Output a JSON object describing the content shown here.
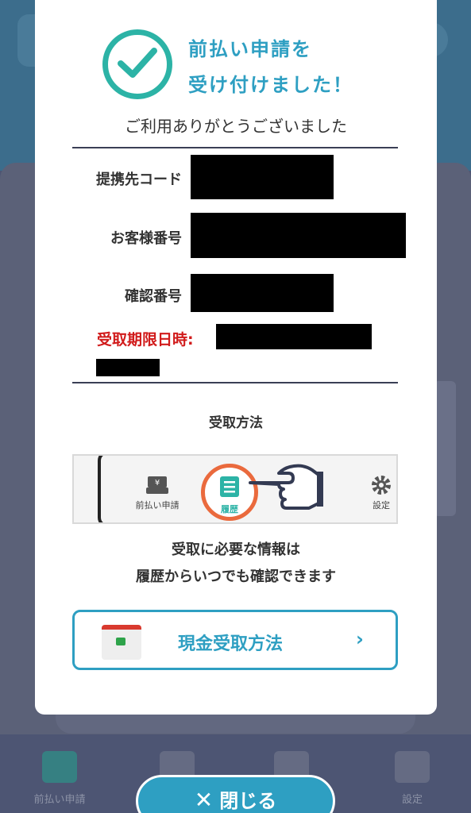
{
  "modal": {
    "title_line1": "前払い申請を",
    "title_line2": "受け付けました！",
    "thanks": "ご利用ありがとうございました",
    "fields": {
      "partner_code_label": "提携先コード",
      "customer_number_label": "お客様番号",
      "confirmation_number_label": "確認番号",
      "deadline_label": "受取期限日時:"
    },
    "receive_method_heading": "受取方法",
    "illustration": {
      "prepay_label": "前払い申請",
      "history_label": "履歴",
      "settings_label": "設定"
    },
    "info_line1": "受取に必要な情報は",
    "info_line2": "履歴からいつでも確認できます",
    "cash_button_label": "現金受取方法",
    "close_button_label": "閉じる"
  },
  "background": {
    "nav_prepay": "前払い申請",
    "nav_settings": "設定"
  },
  "colors": {
    "accent": "#2e9fc2",
    "check": "#2cb3a6",
    "deadline": "#d11b1b",
    "highlight": "#ea6a3d"
  }
}
